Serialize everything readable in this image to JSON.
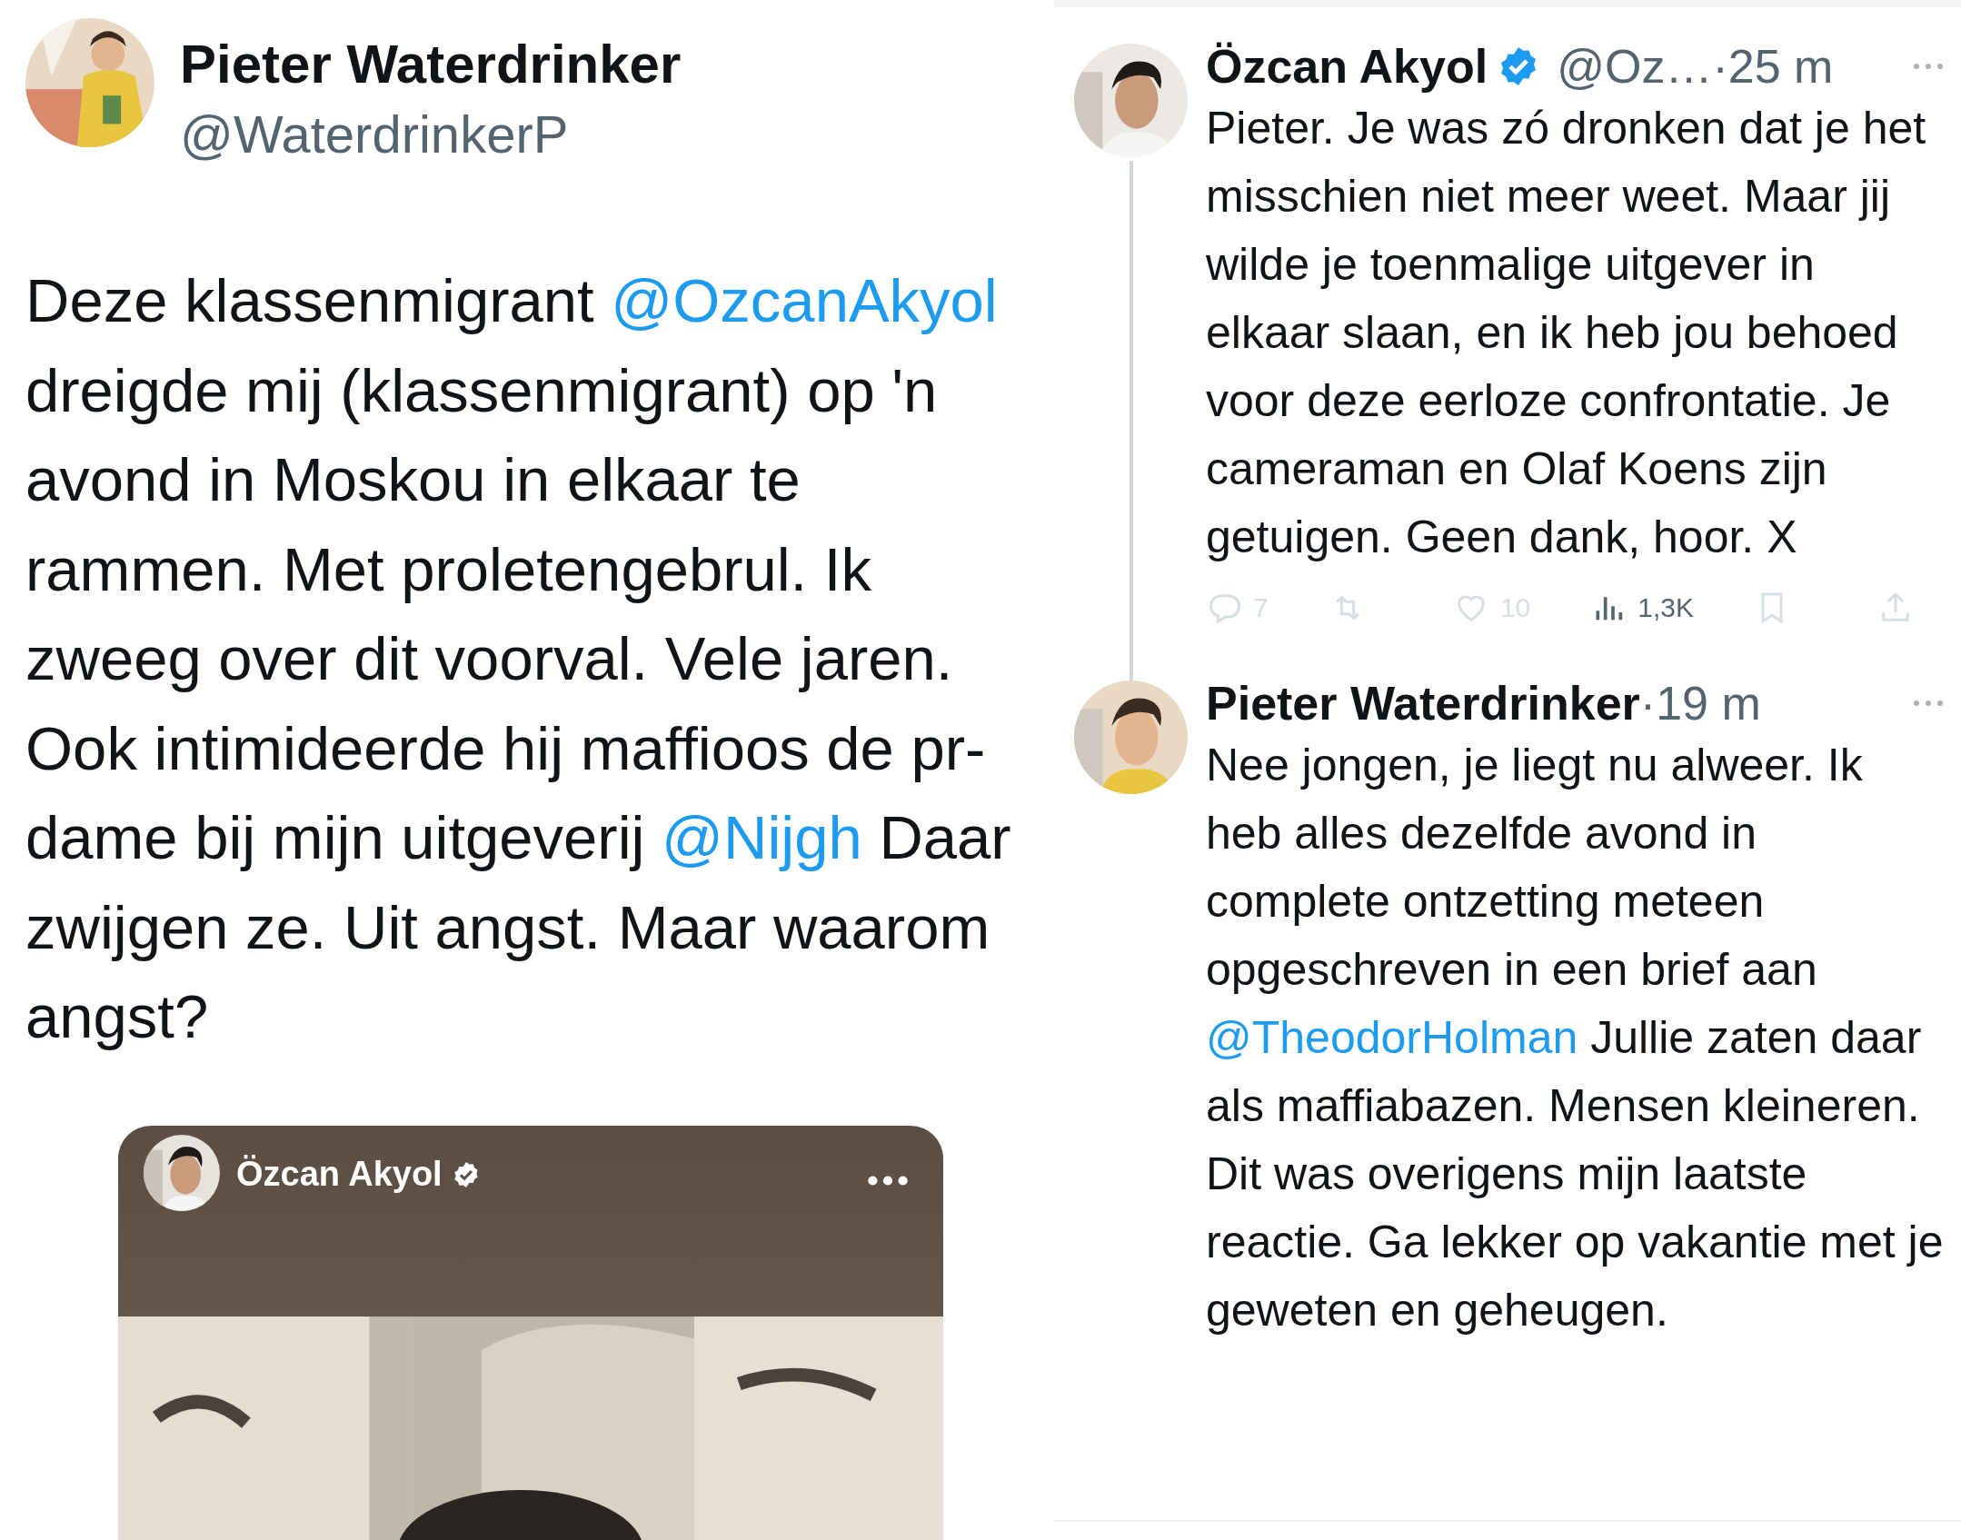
{
  "main_tweet": {
    "author": {
      "name": "Pieter Waterdrinker",
      "handle": "@WaterdrinkerP"
    },
    "text": [
      {
        "kind": "text",
        "text": "Deze klassenmigrant "
      },
      {
        "kind": "mention",
        "text": "@OzcanAkyol"
      },
      {
        "kind": "text",
        "text": " dreigde mij (klassenmigrant) op 'n avond in Moskou in elkaar te rammen. Met proletengebrul. Ik zweeg over dit voorval. Vele jaren. Ook intimideerde hij maffioos de pr-dame bij mijn uitgeverij "
      },
      {
        "kind": "mention",
        "text": "@Nijgh"
      },
      {
        "kind": "text",
        "text": " Daar zwijgen ze. Uit angst. Maar waarom angst?"
      }
    ],
    "embedded_post": {
      "author": "Özcan Akyol",
      "verified": true
    }
  },
  "replies": [
    {
      "name": "Özcan Akyol",
      "verified": true,
      "handle": "@Oz…",
      "time": "·25 m",
      "text": [
        {
          "kind": "text",
          "text": "Pieter. Je was zó dronken dat je het misschien niet meer weet. Maar jij wilde je toenmalige uitgever in elkaar slaan, en ik heb jou behoed voor deze eerloze confrontatie. Je cameraman en Olaf Koens zijn getuigen. Geen dank, hoor. X"
        }
      ],
      "actions": [
        {
          "kind": "reply",
          "count": "7"
        },
        {
          "kind": "repost"
        },
        {
          "kind": "like",
          "count": "10"
        },
        {
          "kind": "views",
          "count": "1,3K"
        },
        {
          "kind": "bookmark"
        },
        {
          "kind": "share"
        }
      ]
    },
    {
      "name": "Pieter Waterdrinker",
      "verified": false,
      "time": "·19 m",
      "text": [
        {
          "kind": "text",
          "text": "Nee jongen, je liegt nu alweer. Ik heb alles dezelfde avond in complete ontzetting meteen opgeschreven in een brief aan "
        },
        {
          "kind": "mention",
          "text": "@TheodorHolman"
        },
        {
          "kind": "text",
          "text": " Jullie zaten daar als maffiabazen. Mensen kleineren. Dit was overigens mijn laatste reactie. Ga lekker op vakantie met je geweten en geheugen."
        }
      ]
    }
  ]
}
